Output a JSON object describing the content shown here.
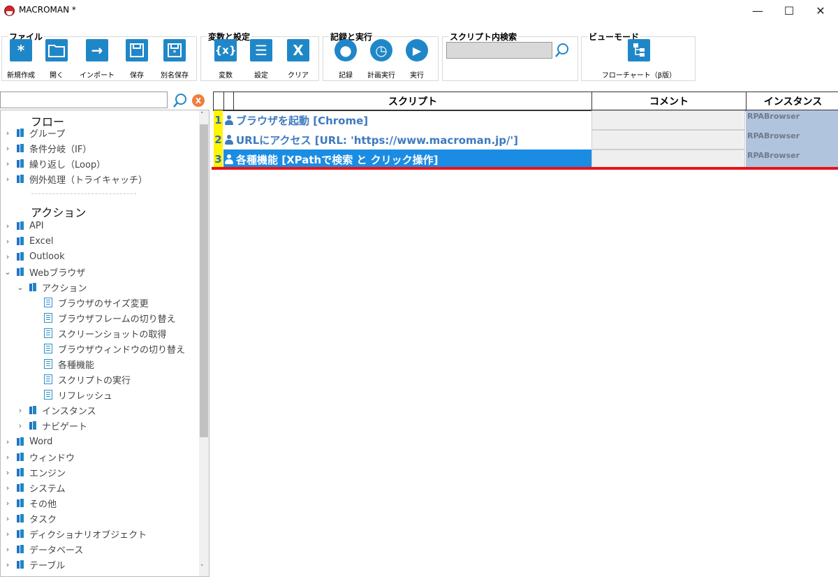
{
  "window": {
    "title": "MACROMAN *",
    "minimize": "—",
    "maximize": "☐",
    "close": "✕"
  },
  "ribbon": {
    "file": {
      "title": "ファイル",
      "buttons": [
        {
          "label": "新規作成",
          "glyph": "*"
        },
        {
          "label": "開く",
          "glyph": ""
        },
        {
          "label": "インポート",
          "glyph": "→"
        },
        {
          "label": "保存",
          "glyph": ""
        },
        {
          "label": "別名保存",
          "glyph": ""
        }
      ]
    },
    "vars": {
      "title": "変数と設定",
      "buttons": [
        {
          "label": "変数",
          "glyph": "{x}"
        },
        {
          "label": "設定",
          "glyph": "☰"
        },
        {
          "label": "クリア",
          "glyph": "X"
        }
      ]
    },
    "record": {
      "title": "記録と実行",
      "buttons": [
        {
          "label": "記録",
          "glyph": "●"
        },
        {
          "label": "計画実行",
          "glyph": "◷"
        },
        {
          "label": "実行",
          "glyph": "▶"
        }
      ]
    },
    "search": {
      "title": "スクリプト内検索",
      "value": ""
    },
    "view": {
      "title": "ビューモード",
      "button": "フローチャート（β版）"
    }
  },
  "tree": {
    "flow_header": "フロー",
    "flow_items": [
      "グループ",
      "条件分岐（IF）",
      "繰り返し（Loop）",
      "例外処理（トライキャッチ）"
    ],
    "action_header": "アクション",
    "action_items_top": [
      "API",
      "Excel",
      "Outlook",
      "Webブラウザ"
    ],
    "web_sub": "アクション",
    "web_actions": [
      "ブラウザのサイズ変更",
      "ブラウザフレームの切り替え",
      "スクリーンショットの取得",
      "ブラウザウィンドウの切り替え",
      "各種機能",
      "スクリプトの実行",
      "リフレッシュ"
    ],
    "web_sub_others": [
      "インスタンス",
      "ナビゲート"
    ],
    "action_items_bottom": [
      "Word",
      "ウィンドウ",
      "エンジン",
      "システム",
      "その他",
      "タスク",
      "ディクショナリオブジェクト",
      "データベース",
      "テーブル"
    ]
  },
  "grid": {
    "headers": {
      "script": "スクリプト",
      "comment": "コメント",
      "instance": "インスタンス"
    },
    "rows": [
      {
        "num": "1",
        "script": "ブラウザを起動 [Chrome]",
        "comment": "",
        "instance": "RPABrowser",
        "selected": false
      },
      {
        "num": "2",
        "script": "URLにアクセス [URL: 'https://www.macroman.jp/']",
        "comment": "",
        "instance": "RPABrowser",
        "selected": false
      },
      {
        "num": "3",
        "script": "各種機能 [XPathで検索 と クリック操作]",
        "comment": "",
        "instance": "RPABrowser",
        "selected": true
      }
    ]
  },
  "colors": {
    "accent": "#1f87c7",
    "selection": "#1b8ce3",
    "row_number_bg": "#fff500",
    "instance_bg": "#b0c4de",
    "insert_line": "#e8121a"
  }
}
